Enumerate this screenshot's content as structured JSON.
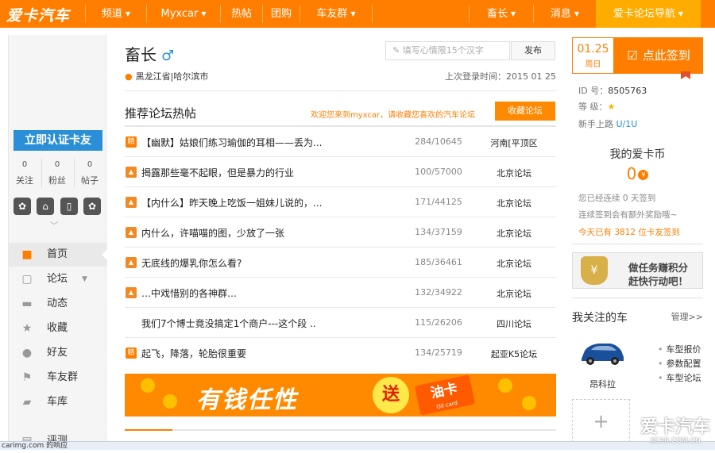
{
  "topbar": {
    "logo": "爱卡汽车",
    "nav": [
      {
        "label": "频道",
        "dropdown": true
      },
      {
        "label": "Myxcar",
        "dropdown": true
      },
      {
        "label": "热帖",
        "dropdown": false
      },
      {
        "label": "团购",
        "dropdown": false
      },
      {
        "label": "车友群",
        "dropdown": true
      },
      {
        "label": "畜长",
        "dropdown": true
      },
      {
        "label": "消息",
        "dropdown": true
      }
    ],
    "guide": "爱卡论坛导航",
    "accent": "#ff7e00"
  },
  "left": {
    "verify_button": "立即认证卡友",
    "stats": [
      {
        "value": "0",
        "label": "关注"
      },
      {
        "value": "0",
        "label": "粉丝"
      },
      {
        "value": "0",
        "label": "帖子"
      }
    ],
    "menu": [
      {
        "label": "首页",
        "icon": "home-icon",
        "active": true
      },
      {
        "label": "论坛",
        "icon": "forum-icon",
        "active": false
      },
      {
        "label": "动态",
        "icon": "chat-icon",
        "active": false
      },
      {
        "label": "收藏",
        "icon": "star-icon",
        "active": false
      },
      {
        "label": "好友",
        "icon": "friends-icon",
        "active": false
      },
      {
        "label": "车友群",
        "icon": "flag-icon",
        "active": false
      },
      {
        "label": "车库",
        "icon": "car-icon",
        "active": false
      },
      {
        "label": "评测",
        "icon": "review-icon",
        "active": false
      }
    ]
  },
  "profile": {
    "name": "畜长",
    "gender_symbol": "♂",
    "mood_placeholder": "填写心情限15个汉字",
    "publish_button": "发布",
    "location": "黑龙江省|哈尔滨市",
    "last_login": "上次登录时间：2015 01 25"
  },
  "recommend": {
    "title": "推荐论坛热帖",
    "welcome": "欢迎您来到myxcar，请收藏您喜欢的汽车论坛",
    "fav_button": "收藏论坛",
    "posts": [
      {
        "tag": "精",
        "title": "【幽默】姑娘们练习瑜伽的耳相——丢为...",
        "count": "284/10645",
        "forum": "河南[平顶区"
      },
      {
        "tag": "图",
        "title": "揭露那些毫不起眼，但是暴力的行业",
        "count": "100/57000",
        "forum": "北京论坛"
      },
      {
        "tag": "图",
        "title": "【内什么】昨天晚上吃饭一姐妹儿说的，...",
        "count": "171/44125",
        "forum": "北京论坛"
      },
      {
        "tag": "图",
        "title": "内什么，许喵喵的图，少放了一张",
        "count": "134/37159",
        "forum": "北京论坛"
      },
      {
        "tag": "图",
        "title": "无底线的爆乳你怎么看?",
        "count": "185/36461",
        "forum": "北京论坛"
      },
      {
        "tag": "图",
        "title": "…中戏惜别的各神群…",
        "count": "132/34922",
        "forum": "北京论坛"
      },
      {
        "tag": "",
        "title": "我们7个博士竟没搞定1个商户---这个段 ..",
        "count": "115/26206",
        "forum": "四川论坛"
      },
      {
        "tag": "精",
        "title": "起飞，降落，轮胎很重要",
        "count": "134/25719",
        "forum": "起亚K5论坛"
      }
    ]
  },
  "banner": {
    "main": "有钱任性",
    "circle": "送",
    "card": "油卡",
    "card_sub": "Oil card"
  },
  "right": {
    "date": "01.25",
    "weekday": "周日",
    "sign_button": "点此签到",
    "id_label": "ID  号：",
    "id_value": "8505763",
    "level_label": "等  级：",
    "level_value": "★",
    "rank_label": "新手上路",
    "rank_value": "U/1U",
    "coins_title": "我的爱卡币",
    "coins_value": "0",
    "coin_symbol": "¥",
    "streak": "您已经连续 0 天签到",
    "hint": "连续签到会有额外奖励哦~",
    "today": "今天已有 3812 位卡友签到",
    "task_line1": "做任务赚积分",
    "task_line2": "赶快行动吧！",
    "cars_title": "我关注的车",
    "manage": "管理>>",
    "car_name": "昂科拉",
    "car_links": [
      "车型报价",
      "参数配置",
      "车型论坛"
    ],
    "add": "+"
  },
  "status_bar": "carimg.com 的响应",
  "watermark": "爱卡汽车",
  "watermark_sub": "XCAR.COM.CN"
}
